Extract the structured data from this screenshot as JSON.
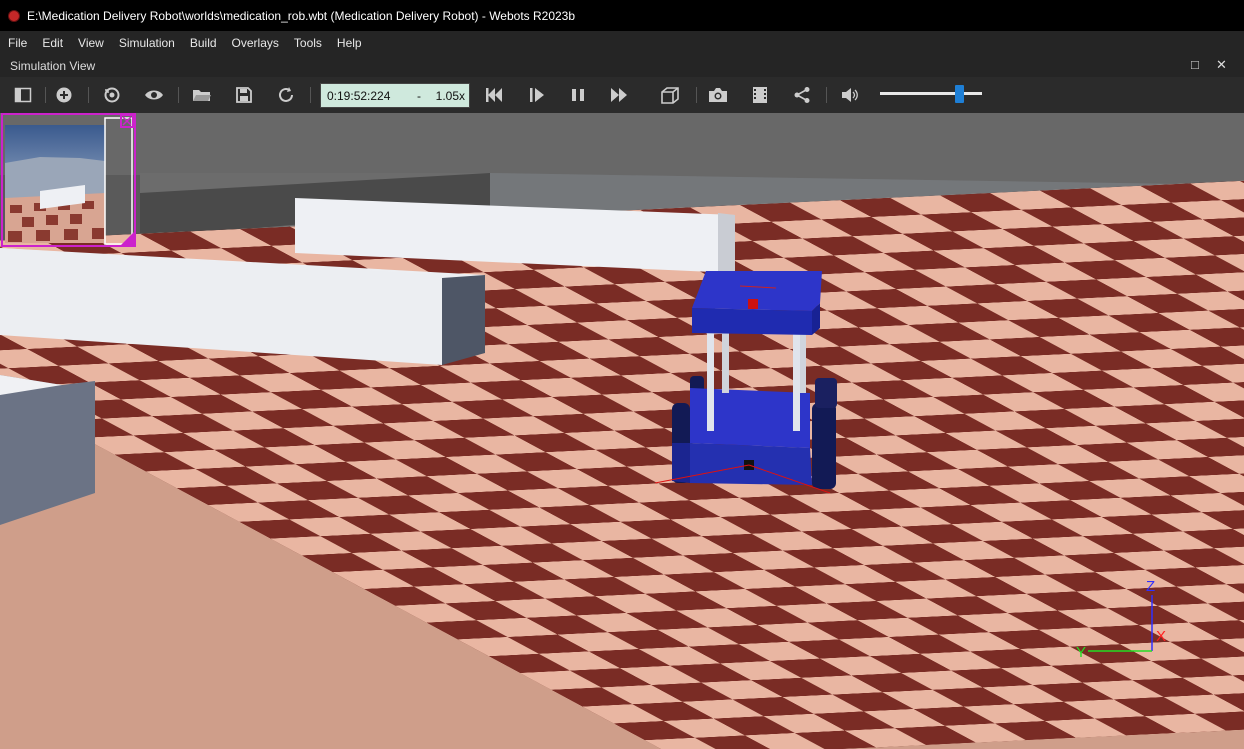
{
  "window": {
    "title": "E:\\Medication Delivery Robot\\worlds\\medication_rob.wbt (Medication Delivery Robot) - Webots R2023b"
  },
  "menu": [
    "File",
    "Edit",
    "View",
    "Simulation",
    "Build",
    "Overlays",
    "Tools",
    "Help"
  ],
  "panel": {
    "title": "Simulation View",
    "maximize_glyph": "□",
    "close_glyph": "✕"
  },
  "toolbar": {
    "time": "0:19:52:224",
    "dash": "-",
    "speed": "1.05x",
    "icons": [
      "toggle-scene-tree-icon",
      "add-node-icon",
      "reset-view-icon",
      "view-eye-icon",
      "open-world-icon",
      "save-world-icon",
      "reload-world-icon",
      "step-back-icon",
      "step-icon",
      "pause-icon",
      "fast-forward-icon",
      "view-cube-icon",
      "screenshot-icon",
      "movie-icon",
      "share-icon",
      "volume-icon"
    ],
    "volume_level": 0.78
  },
  "axes": {
    "x": "X",
    "y": "Y",
    "z": "Z"
  },
  "colors": {
    "x_axis": "#ff2020",
    "y_axis": "#22dd22",
    "z_axis": "#3030ff",
    "robot": "#2a33c9",
    "overlay_border": "#cc22cc"
  }
}
